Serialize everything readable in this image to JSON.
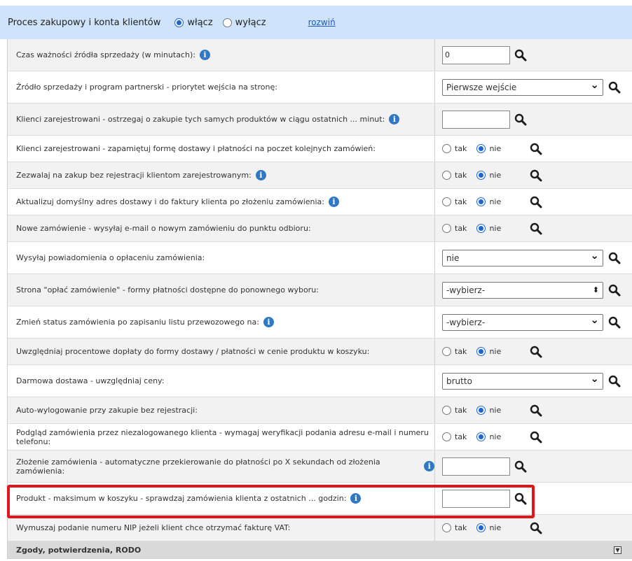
{
  "header": {
    "title": "Proces zakupowy i konta klientów",
    "on_label": "włącz",
    "off_label": "wyłącz",
    "selected": "włącz",
    "expand_link": "rozwiń"
  },
  "rows": [
    {
      "label": "Czas ważności źródła sprzedaży (w minutach):",
      "info": true,
      "control": "text",
      "value": "0"
    },
    {
      "label": "Źródło sprzedaży i program partnerski - priorytet wejścia na stronę:",
      "info": false,
      "control": "select",
      "value": "Pierwsze wejście"
    },
    {
      "label": "Klienci zarejestrowani - ostrzegaj o zakupie tych samych produktów w ciągu ostatnich ... minut:",
      "info": true,
      "control": "text",
      "value": ""
    },
    {
      "label": "Klienci zarejestrowani - zapamiętuj formę dostawy i płatności na poczet kolejnych zamówień:",
      "info": false,
      "control": "yesno",
      "value": "nie"
    },
    {
      "label": "Zezwalaj na zakup bez rejestracji klientom zarejestrowanym:",
      "info": true,
      "control": "yesno",
      "value": "nie"
    },
    {
      "label": "Aktualizuj domyślny adres dostawy i do faktury klienta po złożeniu zamówienia:",
      "info": true,
      "control": "yesno",
      "value": "nie"
    },
    {
      "label": "Nowe zamówienie - wysyłaj e-mail o nowym zamówieniu do punktu odbioru:",
      "info": false,
      "control": "yesno",
      "value": "nie"
    },
    {
      "label": "Wysyłaj powiadomienia o opłaceniu zamówienia:",
      "info": false,
      "control": "select",
      "value": "nie"
    },
    {
      "label": "Strona \"opłać zamówienie\" - formy płatności dostępne do ponownego wyboru:",
      "info": false,
      "control": "multiselect",
      "value": "-wybierz-"
    },
    {
      "label": "Zmień status zamówienia po zapisaniu listu przewozowego na:",
      "info": true,
      "control": "select",
      "value": "-wybierz-"
    },
    {
      "label": "Uwzględniaj procentowe dopłaty do formy dostawy / płatności w cenie produktu w koszyku:",
      "info": false,
      "control": "yesno",
      "value": "nie"
    },
    {
      "label": "Darmowa dostawa - uwzględniaj ceny:",
      "info": false,
      "control": "select",
      "value": "brutto"
    },
    {
      "label": "Auto-wylogowanie przy zakupie bez rejestracji:",
      "info": false,
      "control": "yesno",
      "value": "nie"
    },
    {
      "label": "Podgląd zamówienia przez niezalogowanego klienta - wymagaj weryfikacji podania adresu e-mail i numeru telefonu:",
      "info": false,
      "control": "yesno",
      "value": "nie"
    },
    {
      "label": "Złożenie zamówienia - automatyczne przekierowanie do płatności po X sekundach od złożenia zamówienia:",
      "info": true,
      "control": "text",
      "value": ""
    },
    {
      "label": "Produkt - maksimum w koszyku - sprawdzaj zamówienia klienta z ostatnich ... godzin:",
      "info": true,
      "control": "text",
      "value": ""
    },
    {
      "label": "Wymuszaj podanie numeru NIP jeżeli klient chce otrzymać fakturę VAT:",
      "info": false,
      "control": "yesno",
      "value": "nie"
    }
  ],
  "yes_label": "tak",
  "no_label": "nie",
  "info_glyph": "i",
  "section": {
    "title": "Zgody, potwierdzenia, RODO"
  },
  "colors": {
    "header_bg": "#cfe3fb",
    "accent": "#1a66d9",
    "highlight": "#e3141b"
  }
}
